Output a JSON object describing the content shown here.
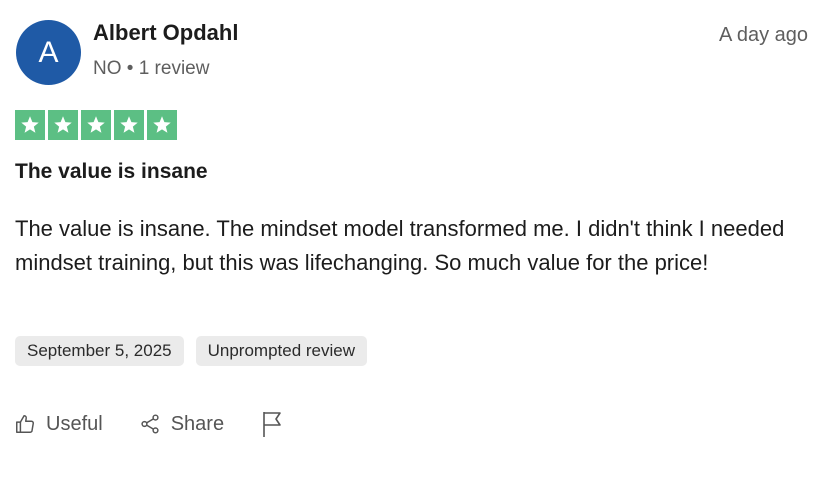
{
  "reviewer": {
    "avatar_initial": "A",
    "name": "Albert Opdahl",
    "meta": "NO • 1 review"
  },
  "review": {
    "posted_ago": "A day ago",
    "rating": 5,
    "rating_max": 5,
    "title": "The value is insane",
    "body": "The value is insane. The mindset model transformed me. I didn't think I needed mindset training, but this was lifechanging. So much value for the price!",
    "date_tag": "September 5, 2025",
    "type_tag": "Unprompted review"
  },
  "actions": {
    "useful_label": "Useful",
    "share_label": "Share"
  },
  "colors": {
    "avatar_bg": "#1f5aa6",
    "star_bg": "#5cbf84"
  },
  "icons": [
    "thumbs-up-icon",
    "share-icon",
    "flag-icon",
    "star-icon"
  ]
}
